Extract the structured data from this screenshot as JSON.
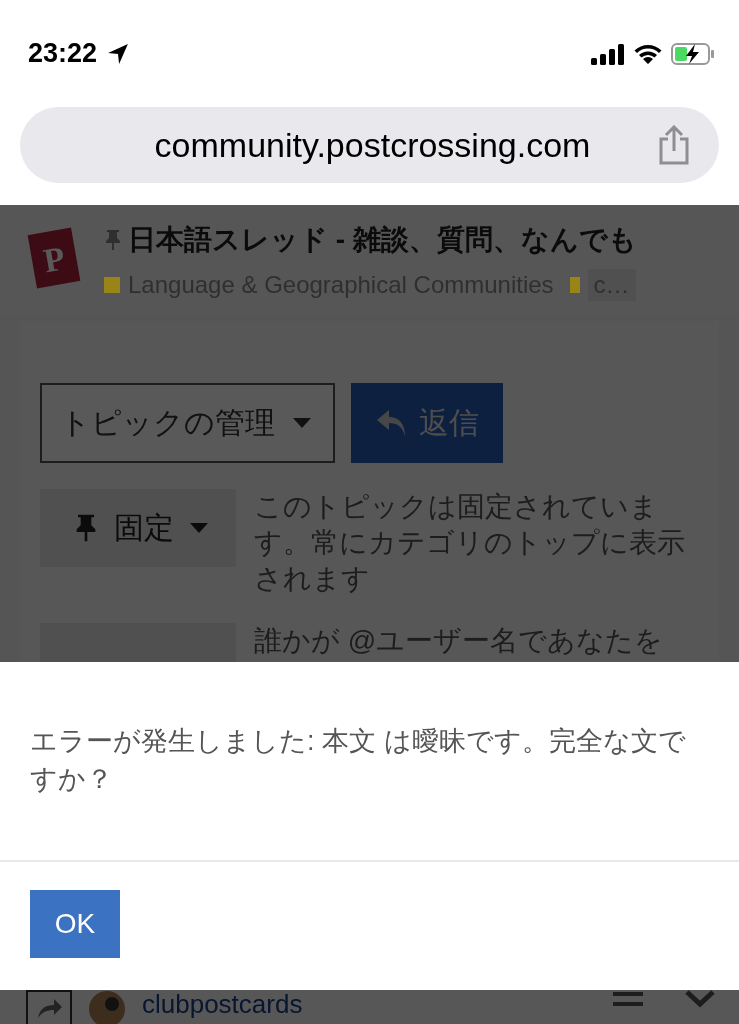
{
  "status_bar": {
    "time": "23:22"
  },
  "browser": {
    "url": "community.postcrossing.com"
  },
  "topic": {
    "logo_letter": "P",
    "title": "日本語スレッド - 雑談、質問、なんでも",
    "pinned": true,
    "categories": [
      {
        "name": "Language & Geographical Communities",
        "color": "#9a8317"
      },
      {
        "name": "c…",
        "color": "#9a8317"
      }
    ]
  },
  "actions": {
    "manage_button": "トピックの管理",
    "reply_button": "返信"
  },
  "notifications": [
    {
      "button": "固定",
      "description": "このトピックは固定されています。常にカテゴリのトップに表示されます"
    },
    {
      "description": "誰かが @ユーザー名であなたを"
    }
  ],
  "dialog": {
    "message": "エラーが発生しました: 本文 は曖昧です。完全な文ですか？",
    "ok_button": "OK"
  },
  "footer": {
    "username": "clubpostcards"
  }
}
